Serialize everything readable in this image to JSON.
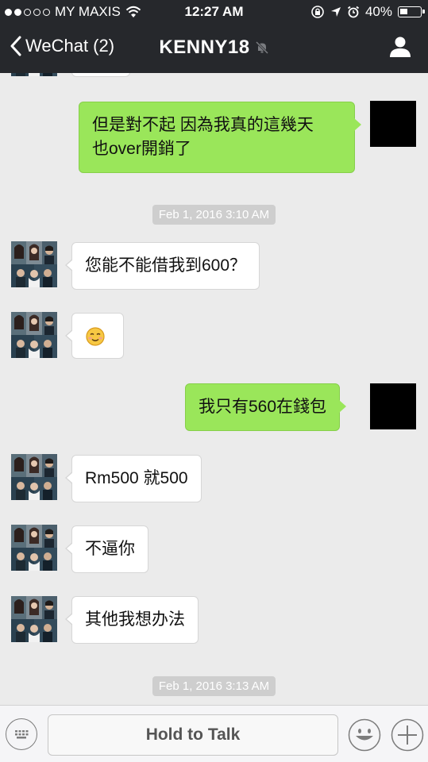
{
  "status_bar": {
    "carrier": "MY MAXIS",
    "time": "12:27 AM",
    "battery": "40%",
    "battery_level": 0.4
  },
  "nav": {
    "back_label": "WeChat (2)",
    "title": "KENNY18"
  },
  "messages": [
    {
      "type": "out",
      "text_line1": "但是對不起  因為我真的這幾天",
      "text_line2": "也over開銷了"
    },
    {
      "type": "timestamp",
      "text": "Feb 1, 2016 3:10 AM"
    },
    {
      "type": "in",
      "text": "您能不能借我到600？"
    },
    {
      "type": "in",
      "emoji": "smile"
    },
    {
      "type": "out",
      "text": "我只有560在錢包"
    },
    {
      "type": "in",
      "text": "Rm500 就500"
    },
    {
      "type": "in",
      "text": "不逼你"
    },
    {
      "type": "in",
      "text": "其他我想办法"
    },
    {
      "type": "timestamp",
      "text": "Feb 1, 2016 3:13 AM"
    }
  ],
  "input_bar": {
    "hold_to_talk": "Hold to Talk"
  },
  "colors": {
    "nav_bg": "#26282c",
    "chat_bg": "#ebebeb",
    "out_bubble": "#9ae65a",
    "in_bubble": "#ffffff"
  },
  "icons": [
    "signal-dots-icon",
    "wifi-icon",
    "lock-rotation-icon",
    "location-arrow-icon",
    "alarm-icon",
    "battery-icon",
    "back-chevron-icon",
    "mute-bell-icon",
    "profile-icon",
    "keyboard-icon",
    "emoji-icon",
    "plus-icon"
  ]
}
